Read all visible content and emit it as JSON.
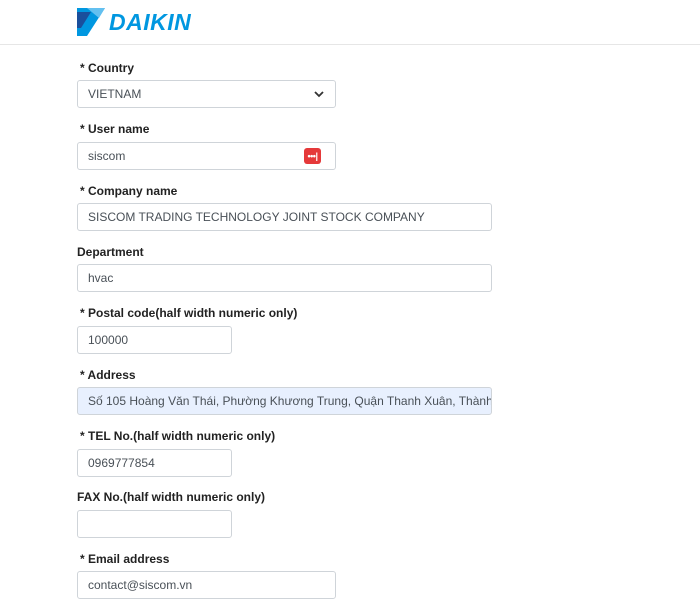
{
  "brand": {
    "name": "DAIKIN",
    "color": "#0097e0"
  },
  "form": {
    "country": {
      "label": "* Country",
      "value": "VIETNAM"
    },
    "username": {
      "label": "* User name",
      "value": "siscom",
      "badge_icon": "password-manager-icon"
    },
    "company": {
      "label": "* Company name",
      "value": "SISCOM TRADING TECHNOLOGY JOINT STOCK COMPANY"
    },
    "department": {
      "label": "Department",
      "value": "hvac"
    },
    "postal": {
      "label": "* Postal code(half width numeric only)",
      "value": "100000"
    },
    "address": {
      "label": "* Address",
      "value": "Số 105 Hoàng Văn Thái, Phường Khương Trung, Quận Thanh Xuân, Thành"
    },
    "tel": {
      "label": "* TEL No.(half width numeric only)",
      "value": "0969777854"
    },
    "fax": {
      "label": "FAX No.(half width numeric only)",
      "value": ""
    },
    "email": {
      "label": "* Email address",
      "value": "contact@siscom.vn"
    }
  }
}
